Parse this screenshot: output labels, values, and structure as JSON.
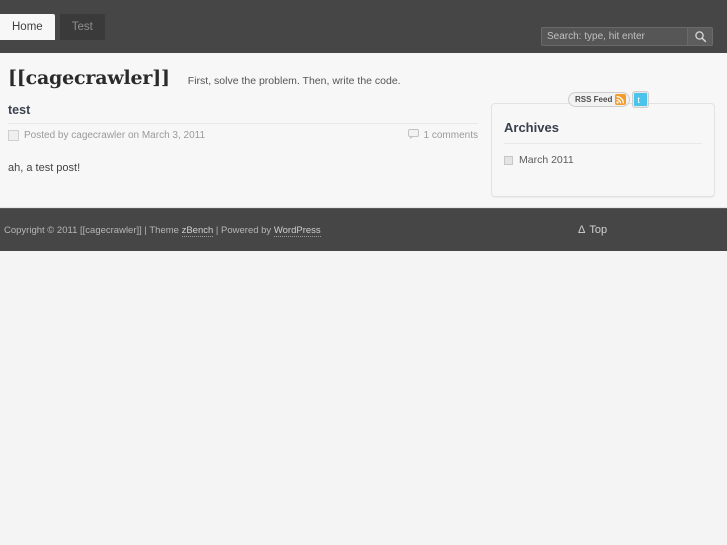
{
  "header": {
    "nav": [
      {
        "label": "Home",
        "active": true
      },
      {
        "label": "Test",
        "active": false
      }
    ],
    "search": {
      "placeholder": "Search: type, hit enter",
      "value": "",
      "button_icon": "search-icon"
    }
  },
  "branding": {
    "site_title": "[[cagecrawler]]",
    "site_description": "First, solve the problem. Then, write the code."
  },
  "post": {
    "title": "test",
    "meta_icon": "calendar-icon",
    "meta": "Posted by cagecrawler on March 3, 2011",
    "comments_icon": "comment-bubble-icon",
    "comments": "1 comments",
    "body": "ah, a test post!"
  },
  "sidebar": {
    "social": {
      "rss_label": "RSS Feed",
      "rss_icon": "rss-icon",
      "twitter_icon": "twitter-icon"
    },
    "widget": {
      "title": "Archives",
      "items": [
        {
          "label": "March 2011",
          "bullet": "square-bullet-icon"
        }
      ]
    }
  },
  "footer": {
    "copyright_prefix": "Copyright © 2011 [[cagecrawler]]",
    "sep1": " | ",
    "theme_prefix": "Theme ",
    "theme_link": "zBench",
    "sep2": " | ",
    "powered_prefix": "Powered by ",
    "powered_link": "WordPress",
    "top_arrow": "Δ",
    "top_label": "Top"
  },
  "colors": {
    "header_bg": "#464646",
    "page_bg": "#f7f7f7",
    "body_bg": "#f4f4f4",
    "rss_orange": "#f29b2e",
    "twitter_blue": "#4cc3ea"
  }
}
